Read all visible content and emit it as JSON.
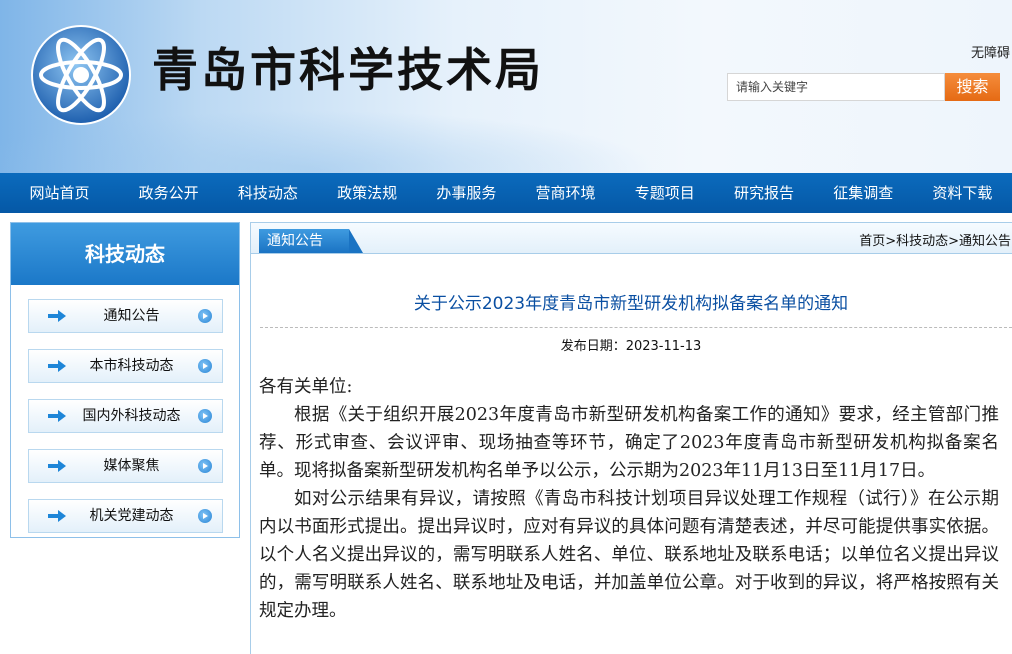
{
  "header": {
    "site_title": "青岛市科学技术局",
    "accessibility_label": "无障碍",
    "search_placeholder": "请输入关键字",
    "search_button": "搜索"
  },
  "nav": [
    "网站首页",
    "政务公开",
    "科技动态",
    "政策法规",
    "办事服务",
    "营商环境",
    "专题项目",
    "研究报告",
    "征集调查",
    "资料下载"
  ],
  "sidebar": {
    "title": "科技动态",
    "items": [
      "通知公告",
      "本市科技动态",
      "国内外科技动态",
      "媒体聚焦",
      "机关党建动态"
    ]
  },
  "main": {
    "tab_label": "通知公告",
    "breadcrumb": "首页>科技动态>通知公告",
    "title": "关于公示2023年度青岛市新型研发机构拟备案名单的通知",
    "pub_date": "发布日期：2023-11-13",
    "greeting": "各有关单位:",
    "paragraphs": [
      "根据《关于组织开展2023年度青岛市新型研发机构备案工作的通知》要求，经主管部门推荐、形式审查、会议评审、现场抽查等环节，确定了2023年度青岛市新型研发机构拟备案名单。现将拟备案新型研发机构名单予以公示，公示期为2023年11月13日至11月17日。",
      "如对公示结果有异议，请按照《青岛市科技计划项目异议处理工作规程（试行）》在公示期内以书面形式提出。提出异议时，应对有异议的具体问题有清楚表述，并尽可能提供事实依据。以个人名义提出异议的，需写明联系人姓名、单位、联系地址及联系电话；以单位名义提出异议的，需写明联系人姓名、联系地址及电话，并加盖单位公章。对于收到的异议，将严格按照有关规定办理。"
    ]
  }
}
